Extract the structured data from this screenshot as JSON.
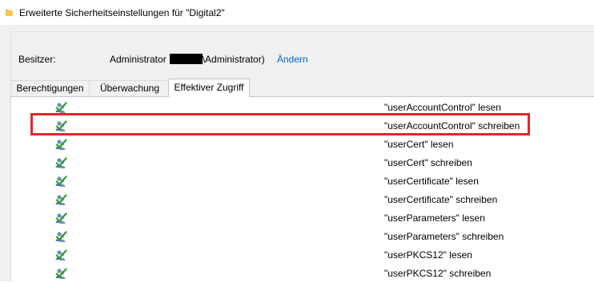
{
  "window": {
    "title": "Erweiterte Sicherheitseinstellungen für \"Digital2\""
  },
  "owner": {
    "label": "Besitzer:",
    "name_prefix": "Administrator",
    "name_suffix": "\\Administrator)",
    "change_label": "Ändern"
  },
  "tabs": [
    {
      "label": "Berechtigungen",
      "active": false
    },
    {
      "label": "Überwachung",
      "active": false
    },
    {
      "label": "Effektiver Zugriff",
      "active": true
    }
  ],
  "permissions": [
    {
      "text": "\"userAccountControl\" lesen",
      "icon": "user-access-icon"
    },
    {
      "text": "\"userAccountControl\" schreiben",
      "icon": "user-access-icon",
      "highlighted": true
    },
    {
      "text": "\"userCert\" lesen",
      "icon": "user-access-icon"
    },
    {
      "text": "\"userCert\" schreiben",
      "icon": "user-access-icon"
    },
    {
      "text": "\"userCertificate\" lesen",
      "icon": "user-access-icon"
    },
    {
      "text": "\"userCertificate\" schreiben",
      "icon": "user-access-icon"
    },
    {
      "text": "\"userParameters\" lesen",
      "icon": "user-access-icon"
    },
    {
      "text": "\"userParameters\" schreiben",
      "icon": "user-access-icon"
    },
    {
      "text": "\"userPKCS12\" lesen",
      "icon": "user-access-icon"
    },
    {
      "text": "\"userPKCS12\" schreiben",
      "icon": "user-access-icon"
    }
  ],
  "colors": {
    "link": "#0066cc",
    "highlight": "#e5262c",
    "check": "#2e9e2e"
  }
}
